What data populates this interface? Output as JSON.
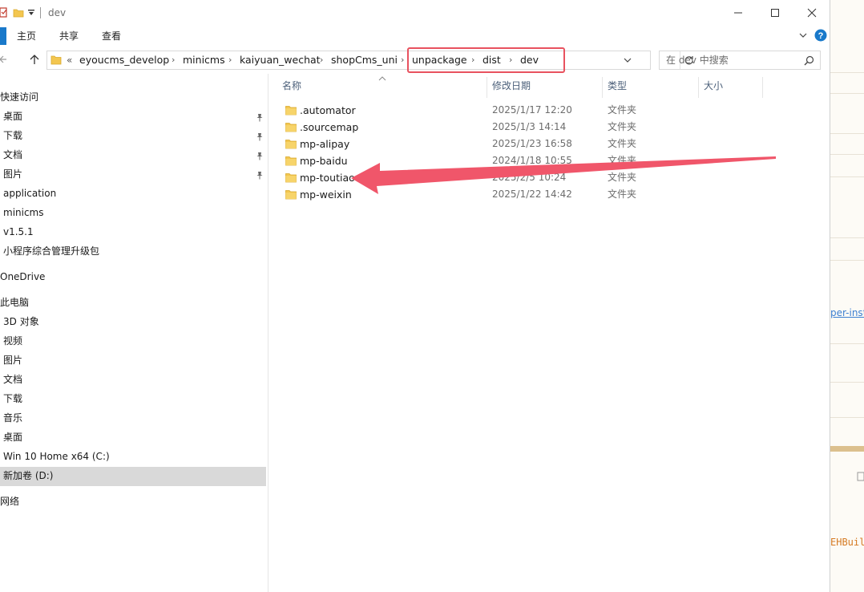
{
  "window": {
    "title": "dev"
  },
  "ribbon": {
    "tabs": [
      "主页",
      "共享",
      "查看"
    ]
  },
  "address": {
    "overflow": "«",
    "crumbs": [
      "eyoucms_develop",
      "minicms",
      "kaiyuan_wechat",
      "shopCms_uni",
      "unpackage",
      "dist",
      "dev"
    ]
  },
  "search": {
    "placeholder": "在 dev 中搜索"
  },
  "nav": {
    "items": [
      {
        "label": "快速访问",
        "pinned": false
      },
      {
        "label": "桌面",
        "pinned": true
      },
      {
        "label": "下载",
        "pinned": true
      },
      {
        "label": "文档",
        "pinned": true
      },
      {
        "label": "图片",
        "pinned": true
      },
      {
        "label": "application",
        "pinned": false
      },
      {
        "label": "minicms",
        "pinned": false
      },
      {
        "label": "v1.5.1",
        "pinned": false
      },
      {
        "label": "小程序综合管理升级包",
        "pinned": false
      },
      {
        "label": "OneDrive",
        "pinned": false
      },
      {
        "label": "此电脑",
        "pinned": false
      },
      {
        "label": "3D 对象",
        "pinned": false
      },
      {
        "label": "视频",
        "pinned": false
      },
      {
        "label": "图片",
        "pinned": false
      },
      {
        "label": "文档",
        "pinned": false
      },
      {
        "label": "下载",
        "pinned": false
      },
      {
        "label": "音乐",
        "pinned": false
      },
      {
        "label": "桌面",
        "pinned": false
      },
      {
        "label": "Win 10 Home x64 (C:)",
        "pinned": false
      },
      {
        "label": "新加卷 (D:)",
        "pinned": false,
        "selected": true
      },
      {
        "label": "网络",
        "pinned": false
      }
    ]
  },
  "columns": {
    "name": "名称",
    "modified": "修改日期",
    "type": "类型",
    "size": "大小"
  },
  "files": [
    {
      "name": ".automator",
      "modified": "2025/1/17 12:20",
      "type": "文件夹"
    },
    {
      "name": ".sourcemap",
      "modified": "2025/1/3 14:14",
      "type": "文件夹"
    },
    {
      "name": "mp-alipay",
      "modified": "2025/1/23 16:58",
      "type": "文件夹"
    },
    {
      "name": "mp-baidu",
      "modified": "2024/1/18 10:55",
      "type": "文件夹"
    },
    {
      "name": "mp-toutiao",
      "modified": "2025/2/5 10:24",
      "type": "文件夹"
    },
    {
      "name": "mp-weixin",
      "modified": "2025/1/22 14:42",
      "type": "文件夹"
    }
  ],
  "background_app": {
    "link_text": "per-inst",
    "code_text": "EHBuil"
  },
  "colors": {
    "highlight": "#e8525f",
    "arrow": "#f0566a",
    "folder": "#f3c64f",
    "accent": "#1979ca"
  }
}
